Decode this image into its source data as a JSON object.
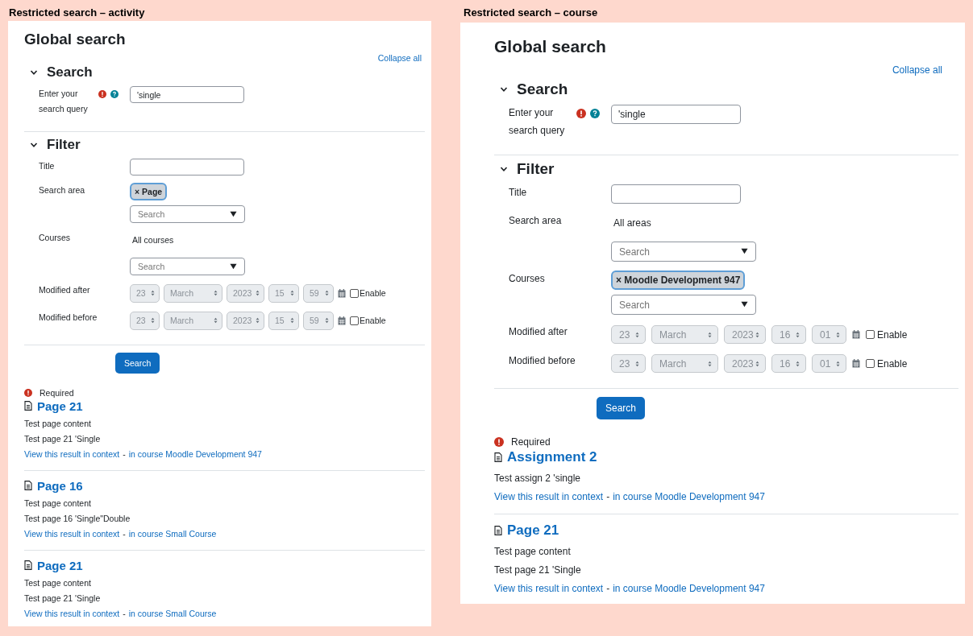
{
  "panels": [
    {
      "caption": "Restricted search – activity",
      "title": "Global search",
      "collapse_link": "Collapse all",
      "search_section": {
        "heading": "Search",
        "expanded": true,
        "query": {
          "label": "Enter your search query",
          "required": true,
          "help": true,
          "value": "'single"
        }
      },
      "filter_section": {
        "heading": "Filter",
        "expanded": true,
        "title_field": {
          "label": "Title"
        },
        "selectors": [
          {
            "label": "Search area",
            "chips": [
              "× Page"
            ],
            "placeholder": "Search"
          },
          {
            "label": "Courses",
            "summary": "All courses",
            "placeholder": "Search"
          }
        ],
        "dates": [
          {
            "label": "Modified after",
            "parts": [
              "23",
              "March",
              "2023",
              "15",
              "59"
            ],
            "disabled": true,
            "enable_label": "Enable",
            "checked": false
          },
          {
            "label": "Modified before",
            "parts": [
              "23",
              "March",
              "2023",
              "15",
              "59"
            ],
            "disabled": true,
            "enable_label": "Enable",
            "checked": false
          }
        ]
      },
      "submit": "Search",
      "required_label": "Required",
      "results": [
        {
          "title": "Page 21",
          "lines": [
            "Test page content",
            "Test page 21 'Single"
          ],
          "context_link": "View this result in context",
          "separator": "-",
          "course_link": "in course Moodle Development 947"
        },
        {
          "title": "Page 16",
          "lines": [
            "Test page content",
            "Test page 16 'Single\"Double"
          ],
          "context_link": "View this result in context",
          "separator": "-",
          "course_link": "in course Small Course"
        },
        {
          "title": "Page 21",
          "lines": [
            "Test page content",
            "Test page 21 'Single"
          ],
          "context_link": "View this result in context",
          "separator": "-",
          "course_link": "in course Small Course"
        }
      ]
    },
    {
      "caption": "Restricted search – course",
      "title": "Global search",
      "collapse_link": "Collapse all",
      "search_section": {
        "heading": "Search",
        "expanded": true,
        "query": {
          "label": "Enter your search query",
          "required": true,
          "help": true,
          "value": "'single"
        }
      },
      "filter_section": {
        "heading": "Filter",
        "expanded": true,
        "title_field": {
          "label": "Title"
        },
        "selectors": [
          {
            "label": "Search area",
            "summary": "All areas",
            "placeholder": "Search"
          },
          {
            "label": "Courses",
            "chips": [
              "× Moodle Development 947"
            ],
            "placeholder": "Search"
          }
        ],
        "dates": [
          {
            "label": "Modified after",
            "parts": [
              "23",
              "March",
              "2023",
              "16",
              "01"
            ],
            "disabled": true,
            "enable_label": "Enable",
            "checked": false
          },
          {
            "label": "Modified before",
            "parts": [
              "23",
              "March",
              "2023",
              "16",
              "01"
            ],
            "disabled": true,
            "enable_label": "Enable",
            "checked": false
          }
        ]
      },
      "submit": "Search",
      "required_label": "Required",
      "results": [
        {
          "title": "Assignment 2",
          "lines": [
            "Test assign 2 'single"
          ],
          "context_link": "View this result in context",
          "separator": "-",
          "course_link": "in course Moodle Development 947"
        },
        {
          "title": "Page 21",
          "lines": [
            "Test page content",
            "Test page 21 'Single"
          ],
          "context_link": "View this result in context",
          "separator": "-",
          "course_link": "in course Moodle Development 947"
        }
      ]
    }
  ]
}
